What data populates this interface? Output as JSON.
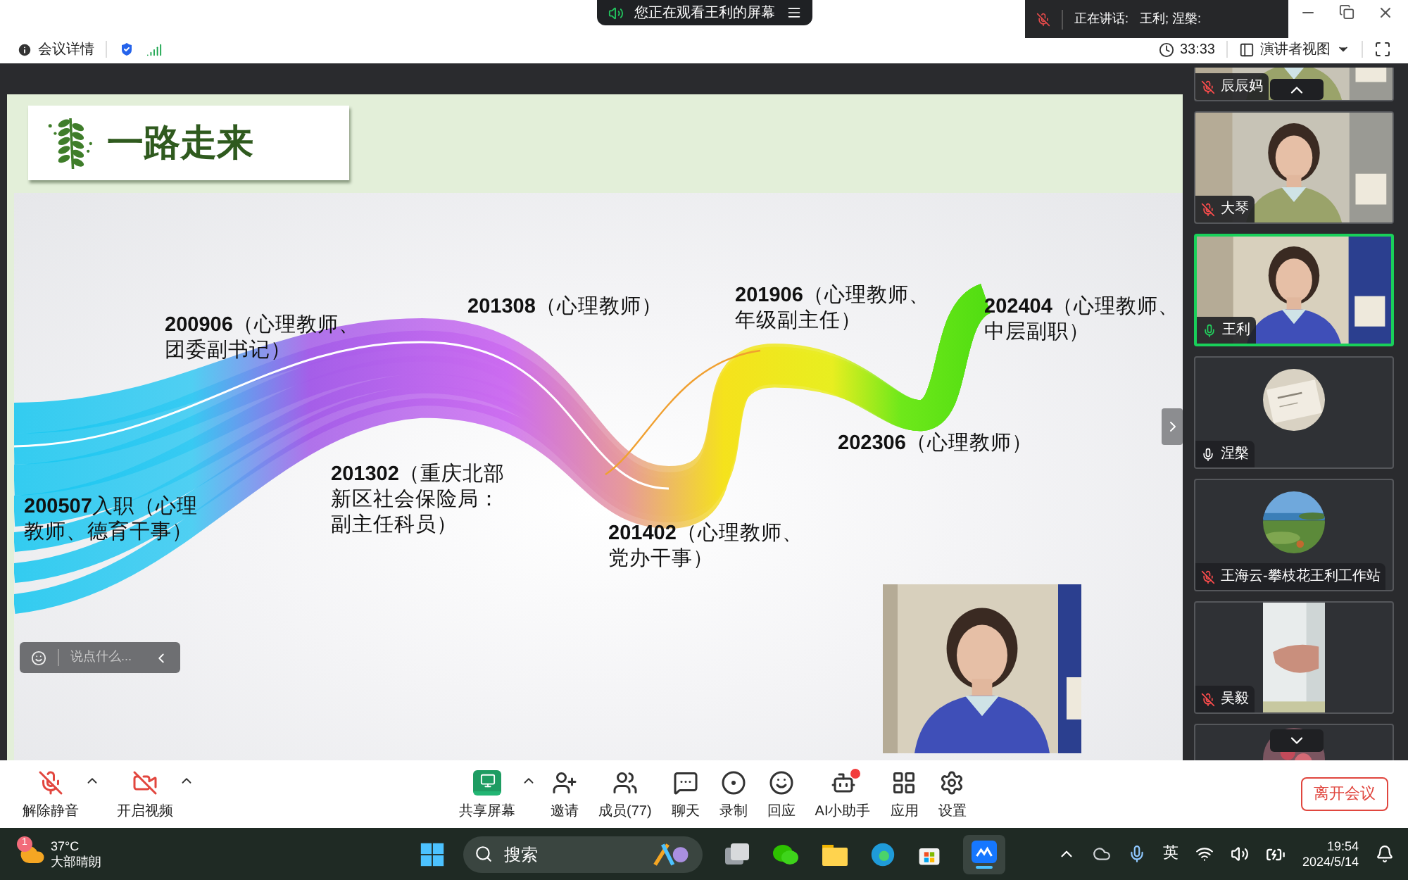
{
  "top_bar": {
    "viewing_notice": "您正在观看王利的屏幕",
    "speaking_label": "正在讲话:",
    "speaking_names": "王利; 涅槃:"
  },
  "info_bar": {
    "meeting_details": "会议详情",
    "duration": "33:33",
    "view_mode": "演讲者视图"
  },
  "slide": {
    "title": "一路走来",
    "milestones": [
      {
        "lines": [
          "**200507**入职（心理",
          "教师、德育干事）"
        ]
      },
      {
        "lines": [
          "**200906**（心理教师、",
          "团委副书记）"
        ]
      },
      {
        "lines": [
          "**201302**（重庆北部",
          "新区社会保险局：",
          "副主任科员）"
        ]
      },
      {
        "lines": [
          "**201308**（心理教师）"
        ]
      },
      {
        "lines": [
          "**201402**（心理教师、",
          "党办干事）"
        ]
      },
      {
        "lines": [
          "**201906**（心理教师、",
          "年级副主任）"
        ]
      },
      {
        "lines": [
          "**202306**（心理教师）"
        ]
      },
      {
        "lines": [
          "**202404**（心理教师、",
          "中层副职）"
        ]
      }
    ],
    "chat_placeholder": "说点什么..."
  },
  "participants": [
    {
      "name": "辰辰妈",
      "muted": true,
      "speaking": false,
      "kind": "video"
    },
    {
      "name": "大琴",
      "muted": true,
      "speaking": false,
      "kind": "video"
    },
    {
      "name": "王利",
      "muted": false,
      "speaking": true,
      "kind": "video"
    },
    {
      "name": "涅槃",
      "muted": false,
      "speaking": false,
      "kind": "avatar"
    },
    {
      "name": "王海云-攀枝花王利工作站",
      "muted": true,
      "speaking": false,
      "kind": "avatar"
    },
    {
      "name": "吴毅",
      "muted": true,
      "speaking": false,
      "kind": "video"
    },
    {
      "kind": "avatar"
    }
  ],
  "toolbar": {
    "left": [
      {
        "label": "解除静音",
        "kind": "mic-off",
        "menu": true,
        "dot": false
      },
      {
        "label": "开启视频",
        "kind": "video-off",
        "menu": true,
        "dot": false
      }
    ],
    "center": [
      {
        "label": "共享屏幕",
        "kind": "share",
        "menu": true,
        "dot": false
      },
      {
        "label": "邀请",
        "kind": "invite",
        "menu": false,
        "dot": false
      },
      {
        "label": "成员(77)",
        "kind": "members",
        "menu": false,
        "dot": false
      },
      {
        "label": "聊天",
        "kind": "chat",
        "menu": false,
        "dot": false
      },
      {
        "label": "录制",
        "kind": "record",
        "menu": false,
        "dot": false
      },
      {
        "label": "回应",
        "kind": "react",
        "menu": false,
        "dot": false
      },
      {
        "label": "AI小助手",
        "kind": "ai",
        "menu": false,
        "dot": true
      },
      {
        "label": "应用",
        "kind": "apps",
        "menu": false,
        "dot": false
      },
      {
        "label": "设置",
        "kind": "settings",
        "menu": false,
        "dot": false
      }
    ],
    "leave_button": "离开会议"
  },
  "taskbar": {
    "weather": {
      "temperature": "37°C",
      "condition": "大部晴朗",
      "badge": "1"
    },
    "search_label": "搜索",
    "input_method": "英",
    "time": "19:54",
    "date": "2024/5/14"
  }
}
